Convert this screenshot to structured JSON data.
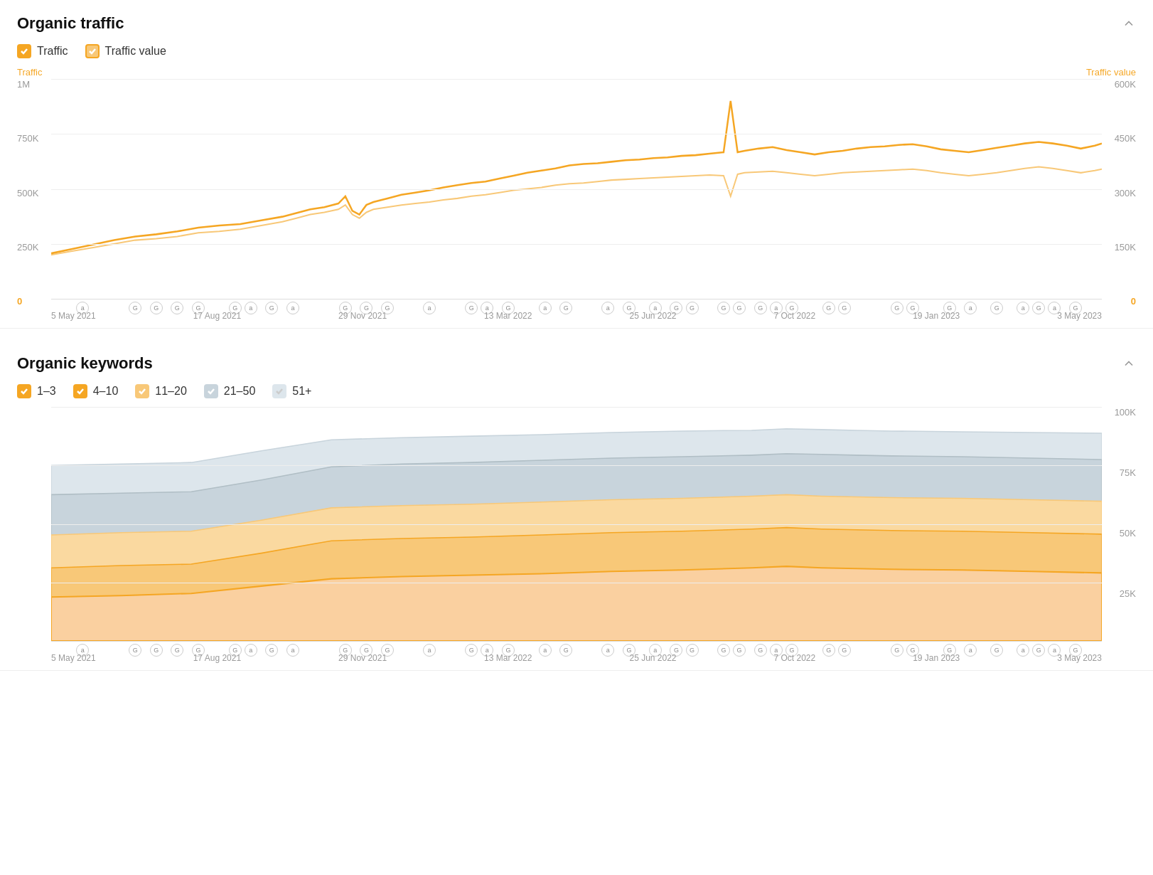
{
  "organic_traffic": {
    "title": "Organic traffic",
    "legend": [
      {
        "id": "traffic",
        "label": "Traffic",
        "checked": true,
        "color_class": "orange"
      },
      {
        "id": "traffic_value",
        "label": "Traffic value",
        "checked": true,
        "color_class": "light-orange"
      }
    ],
    "axis_left_label": "Traffic",
    "axis_right_label": "Traffic value",
    "y_axis_left": [
      "1M",
      "750K",
      "500K",
      "250K",
      "0"
    ],
    "y_axis_right": [
      "600K",
      "450K",
      "300K",
      "150K",
      "0"
    ],
    "x_labels": [
      "5 May 2021",
      "17 Aug 2021",
      "29 Nov 2021",
      "13 Mar 2022",
      "25 Jun 2022",
      "7 Oct 2022",
      "19 Jan 2023",
      "3 May 2023"
    ]
  },
  "organic_keywords": {
    "title": "Organic keywords",
    "legend": [
      {
        "id": "pos1_3",
        "label": "1–3",
        "checked": true,
        "color_class": "orange"
      },
      {
        "id": "pos4_10",
        "label": "4–10",
        "checked": true,
        "color_class": "orange2"
      },
      {
        "id": "pos11_20",
        "label": "11–20",
        "checked": true,
        "color_class": "orange3"
      },
      {
        "id": "pos21_50",
        "label": "21–50",
        "checked": true,
        "color_class": "gray1"
      },
      {
        "id": "pos51plus",
        "label": "51+",
        "checked": true,
        "color_class": "gray2"
      }
    ],
    "y_axis_right": [
      "100K",
      "75K",
      "50K",
      "25K",
      ""
    ],
    "x_labels": [
      "5 May 2021",
      "17 Aug 2021",
      "29 Nov 2021",
      "13 Mar 2022",
      "25 Jun 2022",
      "7 Oct 2022",
      "19 Jan 2023",
      "3 May 2023"
    ]
  },
  "event_icons_traffic": [
    {
      "left_pct": 3,
      "label": "a"
    },
    {
      "left_pct": 8,
      "label": "G"
    },
    {
      "left_pct": 9.5,
      "label": "G"
    },
    {
      "left_pct": 11,
      "label": "G"
    },
    {
      "left_pct": 13,
      "label": "G"
    },
    {
      "left_pct": 17,
      "label": "G"
    },
    {
      "left_pct": 18.5,
      "label": "a"
    },
    {
      "left_pct": 20,
      "label": "G"
    },
    {
      "left_pct": 22,
      "label": "a"
    },
    {
      "left_pct": 28,
      "label": "G"
    },
    {
      "left_pct": 29.5,
      "label": "G"
    },
    {
      "left_pct": 31,
      "label": "G"
    },
    {
      "left_pct": 35,
      "label": "a"
    },
    {
      "left_pct": 39,
      "label": "G"
    },
    {
      "left_pct": 40.5,
      "label": "a"
    },
    {
      "left_pct": 42,
      "label": "G"
    },
    {
      "left_pct": 46,
      "label": "a"
    },
    {
      "left_pct": 48,
      "label": "G"
    },
    {
      "left_pct": 52,
      "label": "a"
    },
    {
      "left_pct": 53.5,
      "label": "G"
    },
    {
      "left_pct": 56,
      "label": "a"
    },
    {
      "left_pct": 57.5,
      "label": "G"
    },
    {
      "left_pct": 59,
      "label": "G"
    },
    {
      "left_pct": 63,
      "label": "G"
    },
    {
      "left_pct": 65,
      "label": "G"
    },
    {
      "left_pct": 66.5,
      "label": "G"
    },
    {
      "left_pct": 68,
      "label": "a"
    },
    {
      "left_pct": 69.5,
      "label": "G"
    },
    {
      "left_pct": 73,
      "label": "G"
    },
    {
      "left_pct": 74.5,
      "label": "G"
    },
    {
      "left_pct": 80,
      "label": "G"
    },
    {
      "left_pct": 81.5,
      "label": "G"
    },
    {
      "left_pct": 85,
      "label": "G"
    },
    {
      "left_pct": 87,
      "label": "a"
    },
    {
      "left_pct": 89,
      "label": "G"
    },
    {
      "left_pct": 92,
      "label": "a"
    },
    {
      "left_pct": 93.5,
      "label": "G"
    },
    {
      "left_pct": 95,
      "label": "a"
    },
    {
      "left_pct": 97,
      "label": "G"
    }
  ]
}
